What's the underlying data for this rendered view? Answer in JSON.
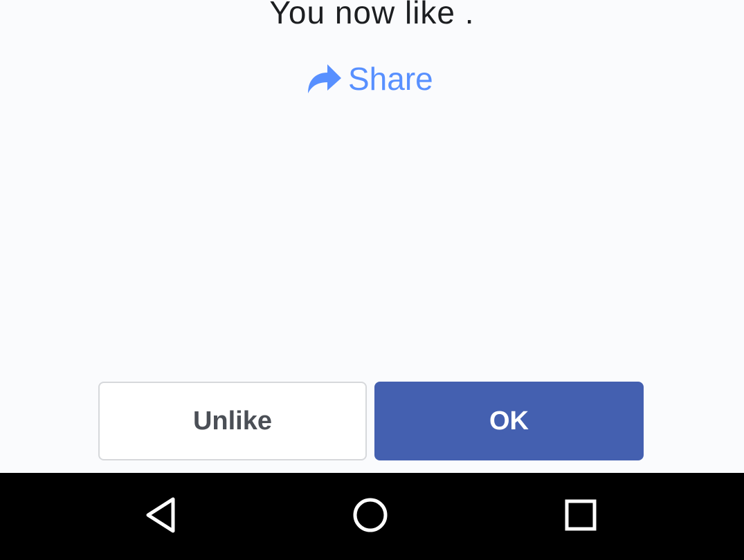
{
  "dialog": {
    "message": "You now like .",
    "share_label": "Share",
    "share_icon": "share-arrow-icon",
    "unlike_label": "Unlike",
    "ok_label": "OK"
  },
  "colors": {
    "accent_link": "#5890ff",
    "primary_button": "#4460b0",
    "background": "#fafbfd",
    "navbar": "#000000"
  },
  "navbar": {
    "back_icon": "back-triangle-icon",
    "home_icon": "home-circle-icon",
    "recents_icon": "recents-square-icon"
  }
}
